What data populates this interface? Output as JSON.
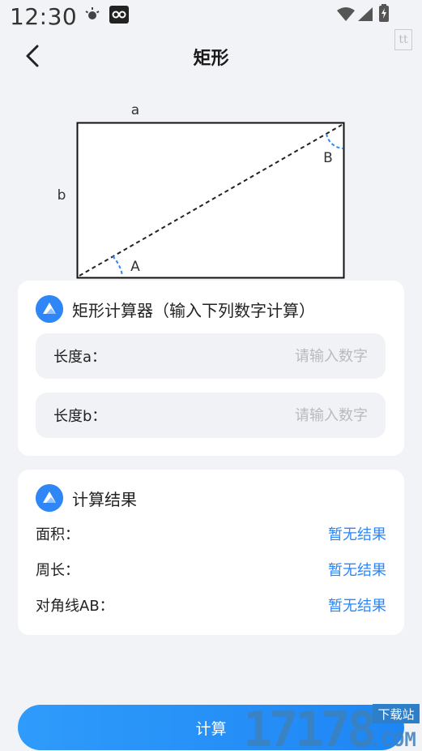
{
  "status_bar": {
    "time": "12:30",
    "icons": [
      "brightness-icon",
      "app-notification-icon",
      "wifi-icon",
      "signal-icon",
      "battery-icon"
    ]
  },
  "header": {
    "title": "矩形",
    "back_icon": "chevron-left-icon"
  },
  "diagram": {
    "label_a": "a",
    "label_b": "b",
    "angle_a": "A",
    "angle_b": "B"
  },
  "input_card": {
    "title": "矩形计算器（输入下列数字计算）",
    "fields": [
      {
        "label": "长度a：",
        "placeholder": "请输入数字",
        "value": ""
      },
      {
        "label": "长度b：",
        "placeholder": "请输入数字",
        "value": ""
      }
    ]
  },
  "result_card": {
    "title": "计算结果",
    "rows": [
      {
        "label": "面积：",
        "value": "暂无结果"
      },
      {
        "label": "周长：",
        "value": "暂无结果"
      },
      {
        "label": "对角线AB：",
        "value": "暂无结果"
      }
    ]
  },
  "footer": {
    "button_label": "计算",
    "watermark_number": "17178",
    "watermark_com": ".COM",
    "watermark_tag": "下载站"
  },
  "colors": {
    "accent": "#2F86F6",
    "background": "#F2F3F7",
    "placeholder": "#B9B9BE"
  }
}
